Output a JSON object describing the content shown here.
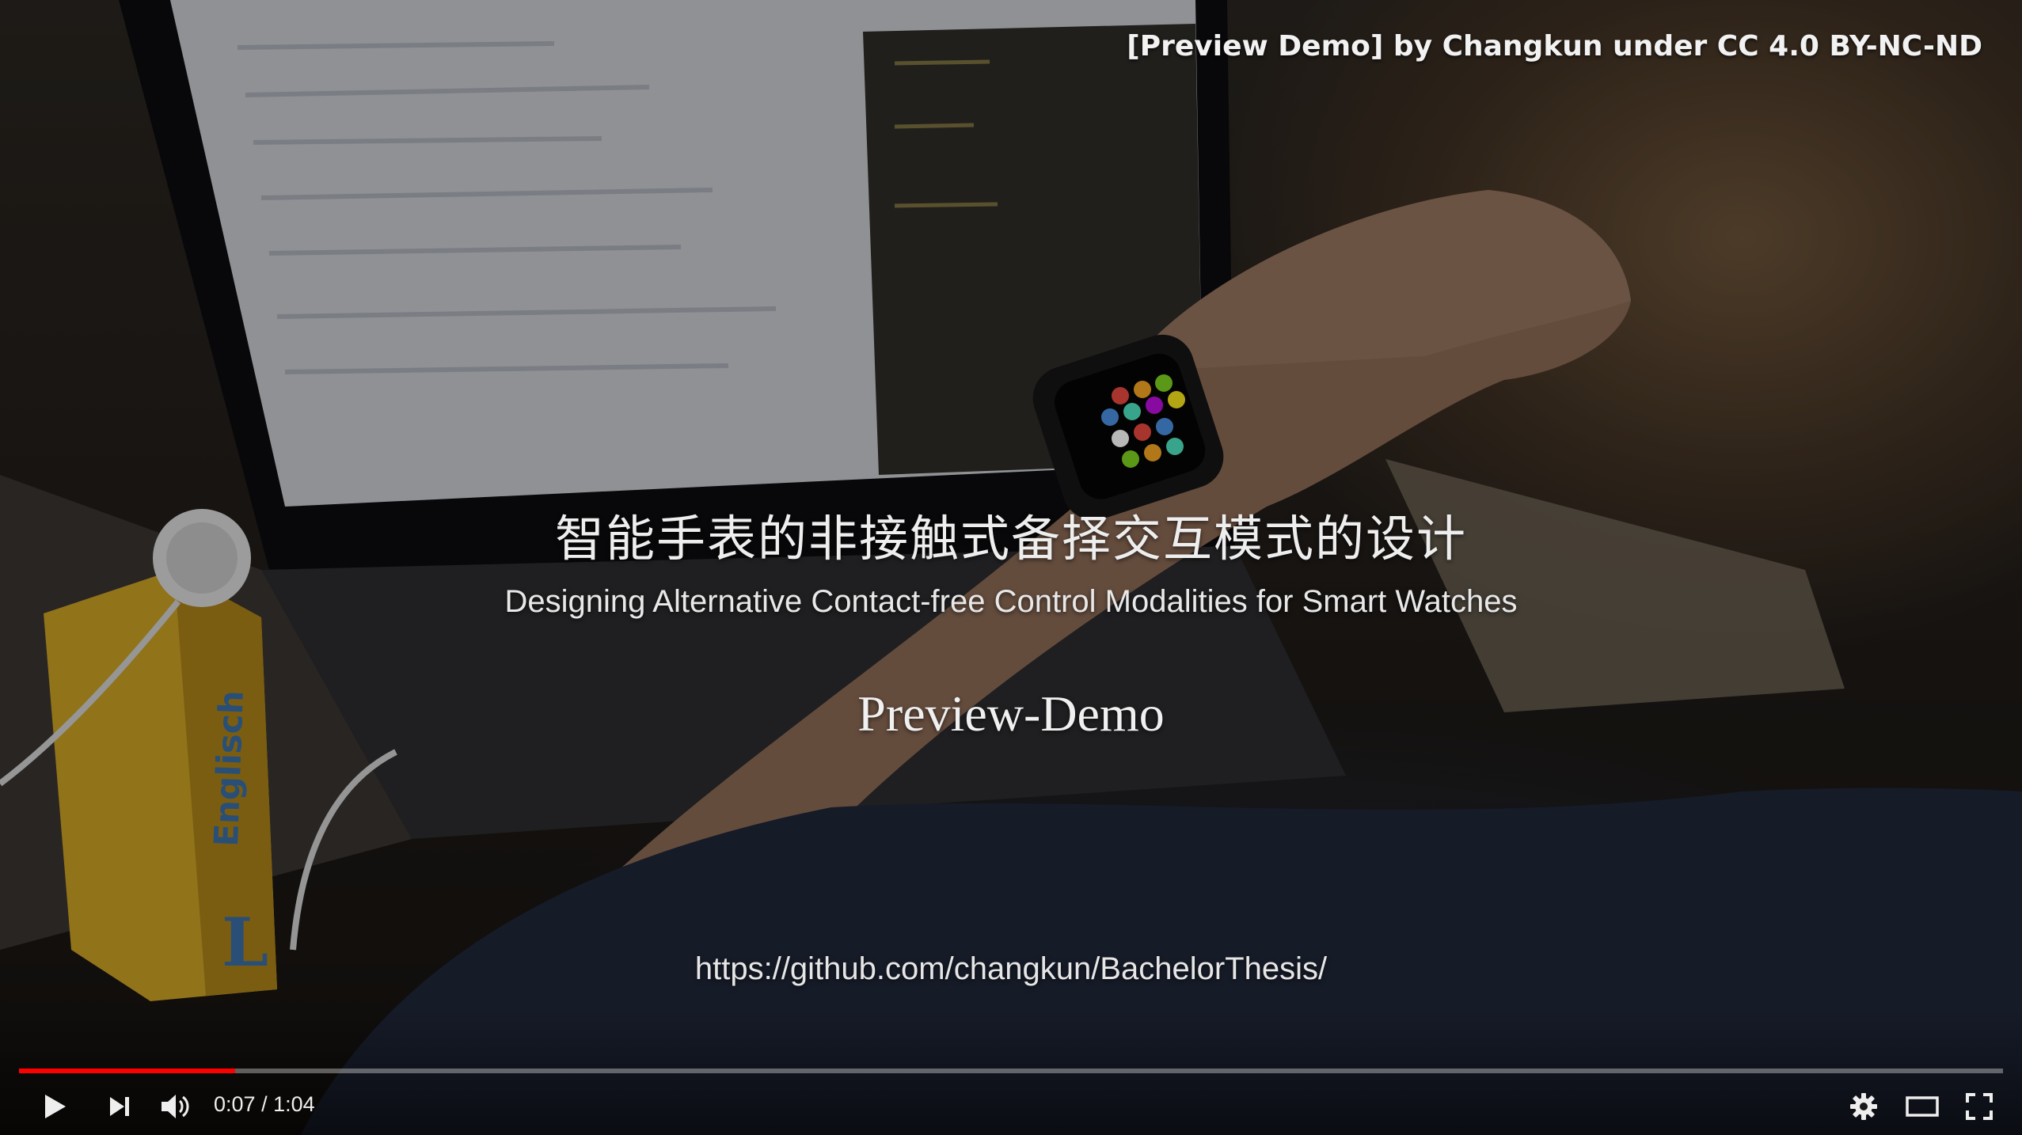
{
  "video": {
    "credit": "[Preview Demo] by Changkun under CC 4.0 BY-NC-ND",
    "title_cn": "智能手表的非接触式备择交互模式的设计",
    "title_en": "Designing Alternative Contact-free Control Modalities for Smart Watches",
    "title_preview": "Preview-Demo",
    "url": "https://github.com/changkun/BachelorThesis/",
    "box_brand": "Englisch",
    "box_logo": "L"
  },
  "player": {
    "current_time": "0:07",
    "separator": " / ",
    "duration": "1:04",
    "played_fraction": 0.109,
    "loaded_fraction": 0.109,
    "progress_color": "#ff0000",
    "buttons": {
      "play": "play-icon",
      "next": "next-icon",
      "volume": "volume-icon",
      "settings": "gear-icon",
      "theater": "theater-mode-icon",
      "fullscreen": "fullscreen-icon"
    }
  }
}
